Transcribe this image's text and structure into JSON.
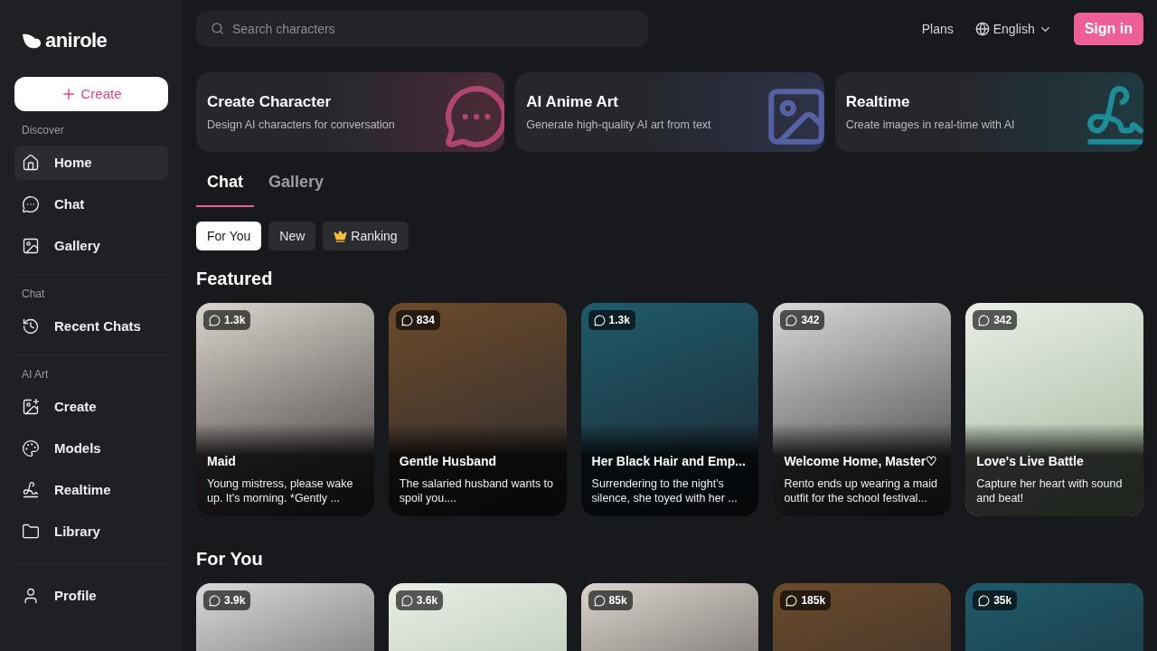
{
  "logo": {
    "text": "anirole"
  },
  "create_button": {
    "label": "Create"
  },
  "sidebar": {
    "sections": [
      {
        "title": "Discover",
        "items": [
          {
            "label": "Home",
            "kind": "home",
            "selected": true
          },
          {
            "label": "Chat",
            "kind": "chat",
            "selected": false
          },
          {
            "label": "Gallery",
            "kind": "gallery",
            "selected": false
          }
        ]
      },
      {
        "title": "Chat",
        "items": [
          {
            "label": "Recent Chats",
            "kind": "history",
            "selected": false
          }
        ]
      },
      {
        "title": "AI Art",
        "items": [
          {
            "label": "Create",
            "kind": "image-plus",
            "selected": false
          },
          {
            "label": "Models",
            "kind": "palette",
            "selected": false
          },
          {
            "label": "Realtime",
            "kind": "scribble",
            "selected": false
          },
          {
            "label": "Library",
            "kind": "folder",
            "selected": false
          }
        ]
      }
    ],
    "footer": [
      {
        "label": "Profile",
        "kind": "user",
        "selected": false
      }
    ]
  },
  "search": {
    "placeholder": "Search characters"
  },
  "header": {
    "plans": "Plans",
    "language": "English",
    "sign_in": "Sign in"
  },
  "feature_cards": [
    {
      "title": "Create Character",
      "subtitle": "Design AI characters for conversation",
      "kind": "chat"
    },
    {
      "title": "AI Anime Art",
      "subtitle": "Generate high-quality AI art from text",
      "kind": "image"
    },
    {
      "title": "Realtime",
      "subtitle": "Create images in real-time with AI",
      "kind": "scribble"
    }
  ],
  "tabs": [
    {
      "label": "Chat",
      "selected": true
    },
    {
      "label": "Gallery",
      "selected": false
    }
  ],
  "filters": [
    {
      "label": "For You",
      "selected": true,
      "kind": "plain"
    },
    {
      "label": "New",
      "selected": false,
      "kind": "plain"
    },
    {
      "label": "Ranking",
      "selected": false,
      "kind": "crown"
    }
  ],
  "featured": {
    "title": "Featured",
    "cards": [
      {
        "count": "1.3k",
        "name": "Maid",
        "description": "Young mistress, please wake up. It's morning. *Gently ..."
      },
      {
        "count": "834",
        "name": "Gentle Husband",
        "description": "The salaried husband wants to spoil you...."
      },
      {
        "count": "1.3k",
        "name": "Her Black Hair and Emp...",
        "description": "Surrendering to the night's silence, she toyed with her ..."
      },
      {
        "count": "342",
        "name": "Welcome Home, Master♡",
        "description": "Rento ends up wearing a maid outfit for the school festival..."
      },
      {
        "count": "342",
        "name": "Love's Live Battle",
        "description": "Capture her heart with sound and beat!"
      }
    ]
  },
  "for_you": {
    "title": "For You",
    "cards": [
      {
        "count": "3.9k"
      },
      {
        "count": "3.6k"
      },
      {
        "count": "85k"
      },
      {
        "count": "185k"
      },
      {
        "count": "35k"
      }
    ]
  }
}
